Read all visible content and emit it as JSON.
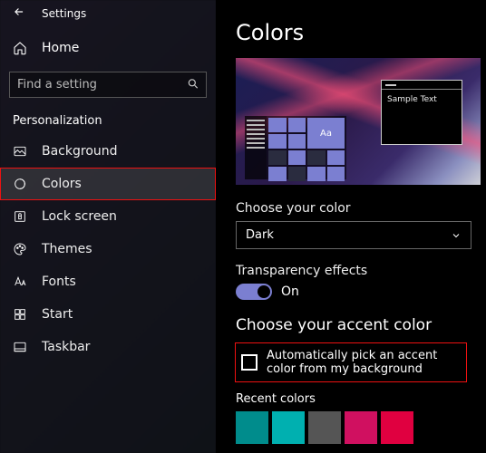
{
  "titlebar": {
    "app": "Settings"
  },
  "home_label": "Home",
  "search_placeholder": "Find a setting",
  "section": "Personalization",
  "nav": [
    {
      "key": "background",
      "label": "Background"
    },
    {
      "key": "colors",
      "label": "Colors",
      "active": true
    },
    {
      "key": "lockscreen",
      "label": "Lock screen"
    },
    {
      "key": "themes",
      "label": "Themes"
    },
    {
      "key": "fonts",
      "label": "Fonts"
    },
    {
      "key": "start",
      "label": "Start"
    },
    {
      "key": "taskbar",
      "label": "Taskbar"
    }
  ],
  "page_title": "Colors",
  "preview": {
    "sample_text": "Sample Text",
    "tile_letter": "Aa"
  },
  "choose_color_label": "Choose your color",
  "choose_color_value": "Dark",
  "transparency_label": "Transparency effects",
  "transparency_state": "On",
  "accent_header": "Choose your accent color",
  "auto_pick_label": "Automatically pick an accent color from my background",
  "recent_label": "Recent colors",
  "recent_colors": [
    "#008c8c",
    "#00b0b0",
    "#555555",
    "#d01060",
    "#e00040"
  ],
  "accent": "#7b7fd1",
  "highlight_color": "#e11"
}
